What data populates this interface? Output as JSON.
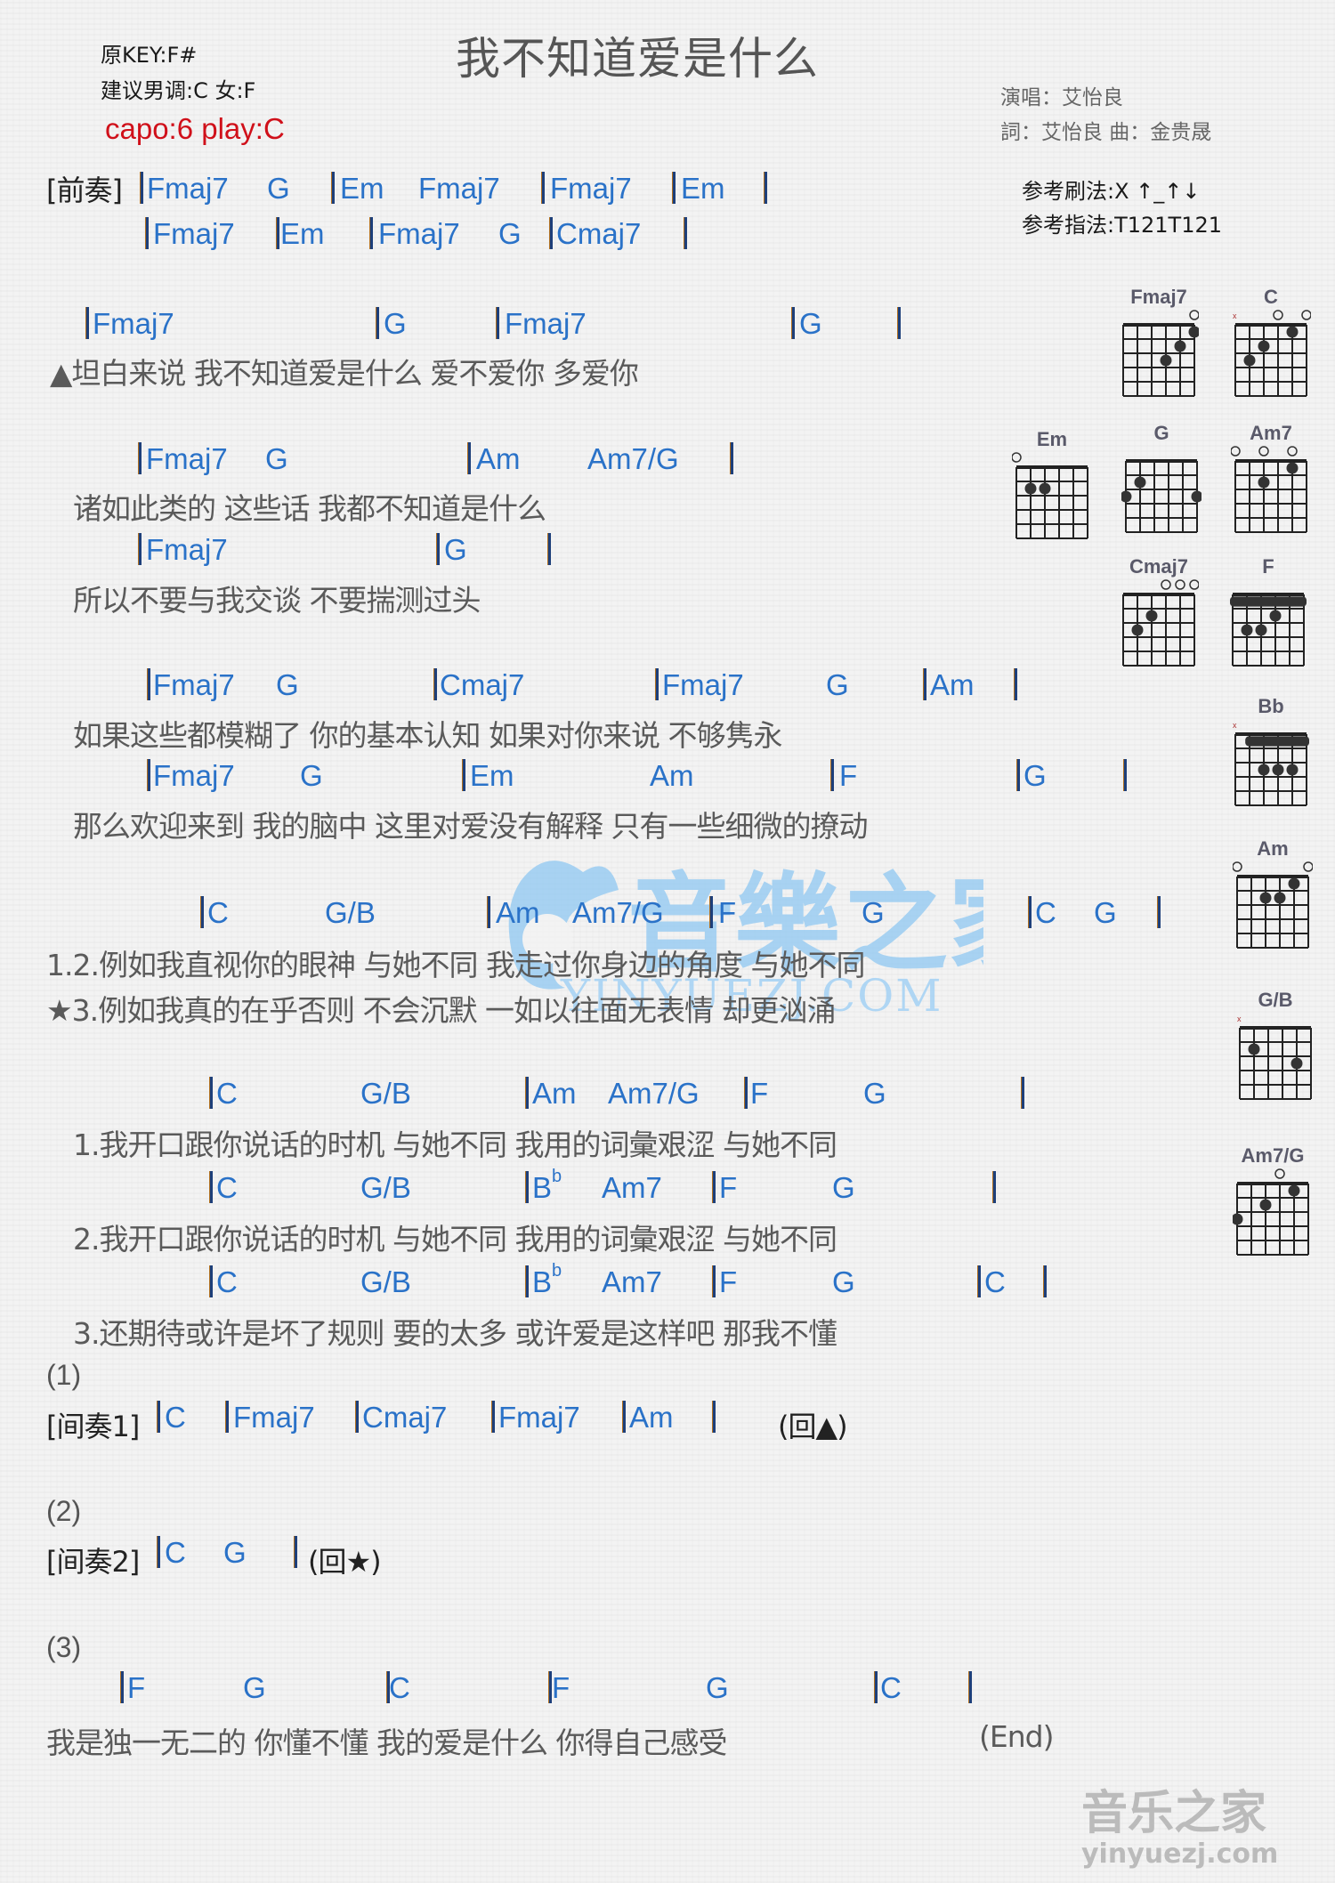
{
  "header": {
    "title": "我不知道爱是什么",
    "original_key": "原KEY:F#",
    "suggested_key": "建议男调:C 女:F",
    "capo": "capo:6 play:C",
    "singer": "演唱：艾怡良",
    "lyricist_composer": "詞：艾怡良    曲：金贵晟",
    "strum_pattern": "参考刷法:X ↑_↑↓",
    "finger_pattern": "参考指法:T121T121"
  },
  "intro": {
    "label": "[前奏]",
    "row1": [
      "Fmaj7",
      "G",
      "Em",
      "Fmaj7",
      "Fmaj7",
      "Em"
    ],
    "row2": [
      "Fmaj7",
      "Em",
      "Fmaj7",
      "G",
      "Cmaj7"
    ]
  },
  "verse": [
    {
      "chords": [
        "Fmaj7",
        "G",
        "Fmaj7",
        "G"
      ],
      "lyric": "▲坦白来说    我不知道爱是什么    爱不爱你      多爱你"
    },
    {
      "chords": [
        "Fmaj7",
        "G",
        "Am",
        "Am7/G"
      ],
      "lyric": "诸如此类的    这些话    我都不知道是什么"
    },
    {
      "chords": [
        "Fmaj7",
        "G"
      ],
      "lyric": "所以不要与我交谈    不要揣测过头"
    },
    {
      "chords": [
        "Fmaj7",
        "G",
        "Cmaj7",
        "Fmaj7",
        "G",
        "Am"
      ],
      "lyric": "如果这些都模糊了    你的基本认知    如果对你来说    不够隽永"
    },
    {
      "chords": [
        "Fmaj7",
        "G",
        "Em",
        "Am",
        "F",
        "G"
      ],
      "lyric": "那么欢迎来到    我的脑中    这里对爱没有解释    只有一些细微的撩动"
    }
  ],
  "chorus_a": {
    "chords": [
      "C",
      "G/B",
      "Am",
      "Am7/G",
      "F",
      "G",
      "C",
      "G"
    ],
    "lyric1": "1.2.例如我直视你的眼神    与她不同        我走过你身边的角度    与她不同",
    "lyric2": "★3.例如我真的在乎否则    不会沉默        一如以往面无表情        却更汹涌"
  },
  "chorus_b": [
    {
      "chords": [
        "C",
        "G/B",
        "Am",
        "Am7/G",
        "F",
        "G"
      ],
      "lyric": "1.我开口跟你说话的时机    与她不同        我用的词彙艰涩    与她不同"
    },
    {
      "chords": [
        "C",
        "G/B",
        "B",
        "Am7",
        "F",
        "G"
      ],
      "flat": "b",
      "lyric": "2.我开口跟你说话的时机    与她不同    我用的词彙艰涩    与她不同"
    },
    {
      "chords": [
        "C",
        "G/B",
        "B",
        "Am7",
        "F",
        "G",
        "C"
      ],
      "flat": "b",
      "lyric": "3.还期待或许是坏了规则    要的太多    或许爱是这样吧    那我不懂"
    }
  ],
  "interlude1": {
    "marker": "(1)",
    "label": "[间奏1]",
    "chords": [
      "C",
      "Fmaj7",
      "Cmaj7",
      "Fmaj7",
      "Am"
    ],
    "return": "(回▲)"
  },
  "interlude2": {
    "marker": "(2)",
    "label": "[间奏2]",
    "chords": [
      "C",
      "G"
    ],
    "return": "(回★)"
  },
  "outro": {
    "marker": "(3)",
    "chords": [
      "F",
      "G",
      "C",
      "F",
      "G",
      "C"
    ],
    "lyric": "我是独一无二的    你懂不懂    我的爱是什么    你得自己感受",
    "end": "(End)"
  },
  "chord_diagrams": [
    {
      "name": "Fmaj7",
      "open": [
        6
      ],
      "muted": [],
      "dots": [
        [
          4,
          3
        ],
        [
          5,
          2
        ],
        [
          6,
          1
        ]
      ],
      "barre": null
    },
    {
      "name": "C",
      "open": [
        4,
        6
      ],
      "muted": [
        1
      ],
      "dots": [
        [
          2,
          3
        ],
        [
          3,
          2
        ],
        [
          5,
          1
        ]
      ],
      "barre": null
    },
    {
      "name": "Em",
      "open": [
        1
      ],
      "muted": [],
      "dots": [
        [
          2,
          2
        ],
        [
          3,
          2
        ]
      ],
      "barre": null
    },
    {
      "name": "G",
      "open": [],
      "muted": [],
      "dots": [
        [
          1,
          3
        ],
        [
          2,
          2
        ],
        [
          6,
          3
        ]
      ],
      "barre": null
    },
    {
      "name": "Am7",
      "open": [
        1,
        3,
        5
      ],
      "muted": [],
      "dots": [
        [
          3,
          2
        ],
        [
          5,
          1
        ]
      ],
      "barre": null
    },
    {
      "name": "Cmaj7",
      "open": [
        4,
        5,
        6
      ],
      "muted": [],
      "dots": [
        [
          2,
          3
        ],
        [
          3,
          2
        ]
      ],
      "barre": null
    },
    {
      "name": "F",
      "open": [],
      "muted": [],
      "dots": [
        [
          2,
          3
        ],
        [
          3,
          3
        ],
        [
          4,
          2
        ]
      ],
      "barre": 1
    },
    {
      "name": "Bb",
      "open": [],
      "muted": [
        1
      ],
      "dots": [
        [
          3,
          3
        ],
        [
          4,
          3
        ],
        [
          5,
          3
        ]
      ],
      "barre": 1
    },
    {
      "name": "Am",
      "open": [
        1,
        6
      ],
      "muted": [],
      "dots": [
        [
          3,
          2
        ],
        [
          4,
          2
        ],
        [
          5,
          1
        ]
      ],
      "barre": null
    },
    {
      "name": "G/B",
      "open": [],
      "muted": [
        1
      ],
      "dots": [
        [
          2,
          2
        ],
        [
          5,
          3
        ]
      ],
      "barre": null
    },
    {
      "name": "Am7/G",
      "open": [
        4
      ],
      "muted": [],
      "dots": [
        [
          1,
          3
        ],
        [
          3,
          2
        ],
        [
          5,
          1
        ]
      ],
      "barre": null
    }
  ],
  "watermark": {
    "logo_text": "音樂之家",
    "site_text": "YINYUEZJ.COM",
    "corner_text": "音乐之家",
    "corner_url": "yinyuezj.com"
  }
}
